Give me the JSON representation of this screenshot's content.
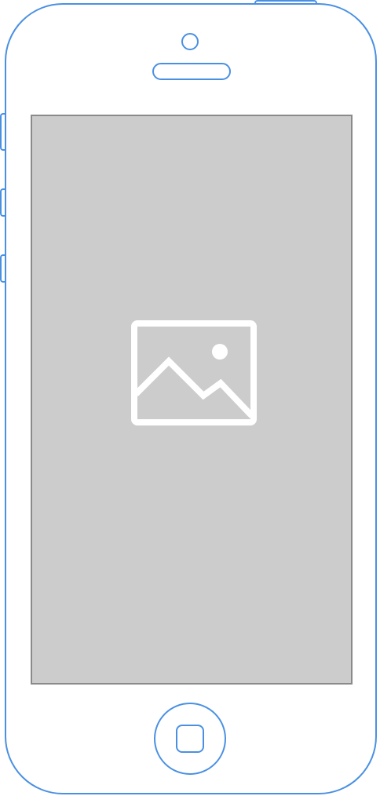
{
  "device": {
    "type": "smartphone-wireframe",
    "outline_color": "#4a90e2",
    "screen_color": "#cccccc",
    "screen_border_color": "#8a8a8a"
  },
  "screen": {
    "content": "image-placeholder",
    "icon": "image-placeholder-icon",
    "icon_color": "#ffffff"
  },
  "hardware": {
    "buttons": [
      "top-power-button",
      "side-mute-switch",
      "side-volume-up-button",
      "side-volume-down-button",
      "home-button"
    ],
    "sensors": [
      "front-camera",
      "earpiece-speaker"
    ]
  }
}
